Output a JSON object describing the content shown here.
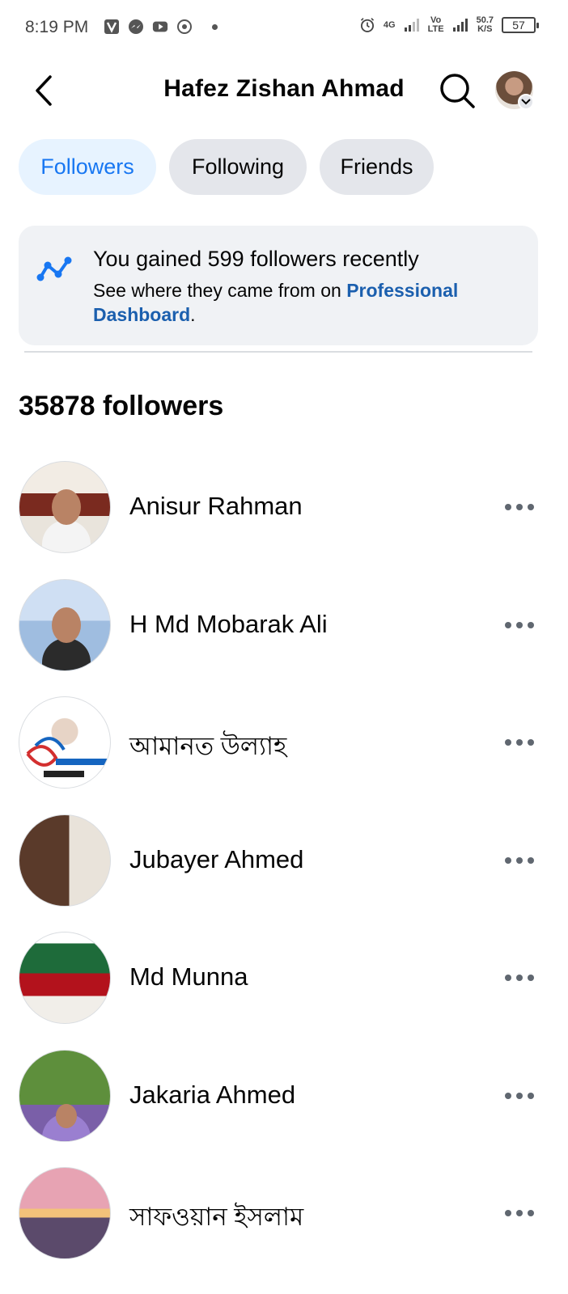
{
  "status_bar": {
    "time": "8:19 PM",
    "network_4g": "4G",
    "volte_top": "Vo",
    "volte_bottom": "LTE",
    "speed_top": "50.7",
    "speed_bottom": "K/S",
    "battery": "57"
  },
  "header": {
    "title": "Hafez Zishan Ahmad"
  },
  "tabs": [
    {
      "label": "Followers",
      "active": true
    },
    {
      "label": "Following",
      "active": false
    },
    {
      "label": "Friends",
      "active": false
    }
  ],
  "insight": {
    "title": "You gained 599 followers recently",
    "body_prefix": "See where they came from on ",
    "link": "Professional Dashboard",
    "body_suffix": "."
  },
  "followers_count": "35878 followers",
  "followers": [
    {
      "name": "Anisur Rahman"
    },
    {
      "name": "H Md Mobarak Ali"
    },
    {
      "name": "আমানত উল্যাহ"
    },
    {
      "name": "Jubayer Ahmed"
    },
    {
      "name": "Md Munna"
    },
    {
      "name": "Jakaria Ahmed"
    },
    {
      "name": "সাফওয়ান ইসলাম"
    }
  ],
  "colors": {
    "accent": "#1877f2",
    "tab_active_bg": "#e7f3ff",
    "tab_bg": "#e4e6eb",
    "card_bg": "#f0f2f5",
    "link": "#1b5fae"
  },
  "icons": {
    "back": "chevron-left-icon",
    "search": "search-icon",
    "more": "more-horizontal-icon",
    "insight": "line-chart-icon"
  }
}
